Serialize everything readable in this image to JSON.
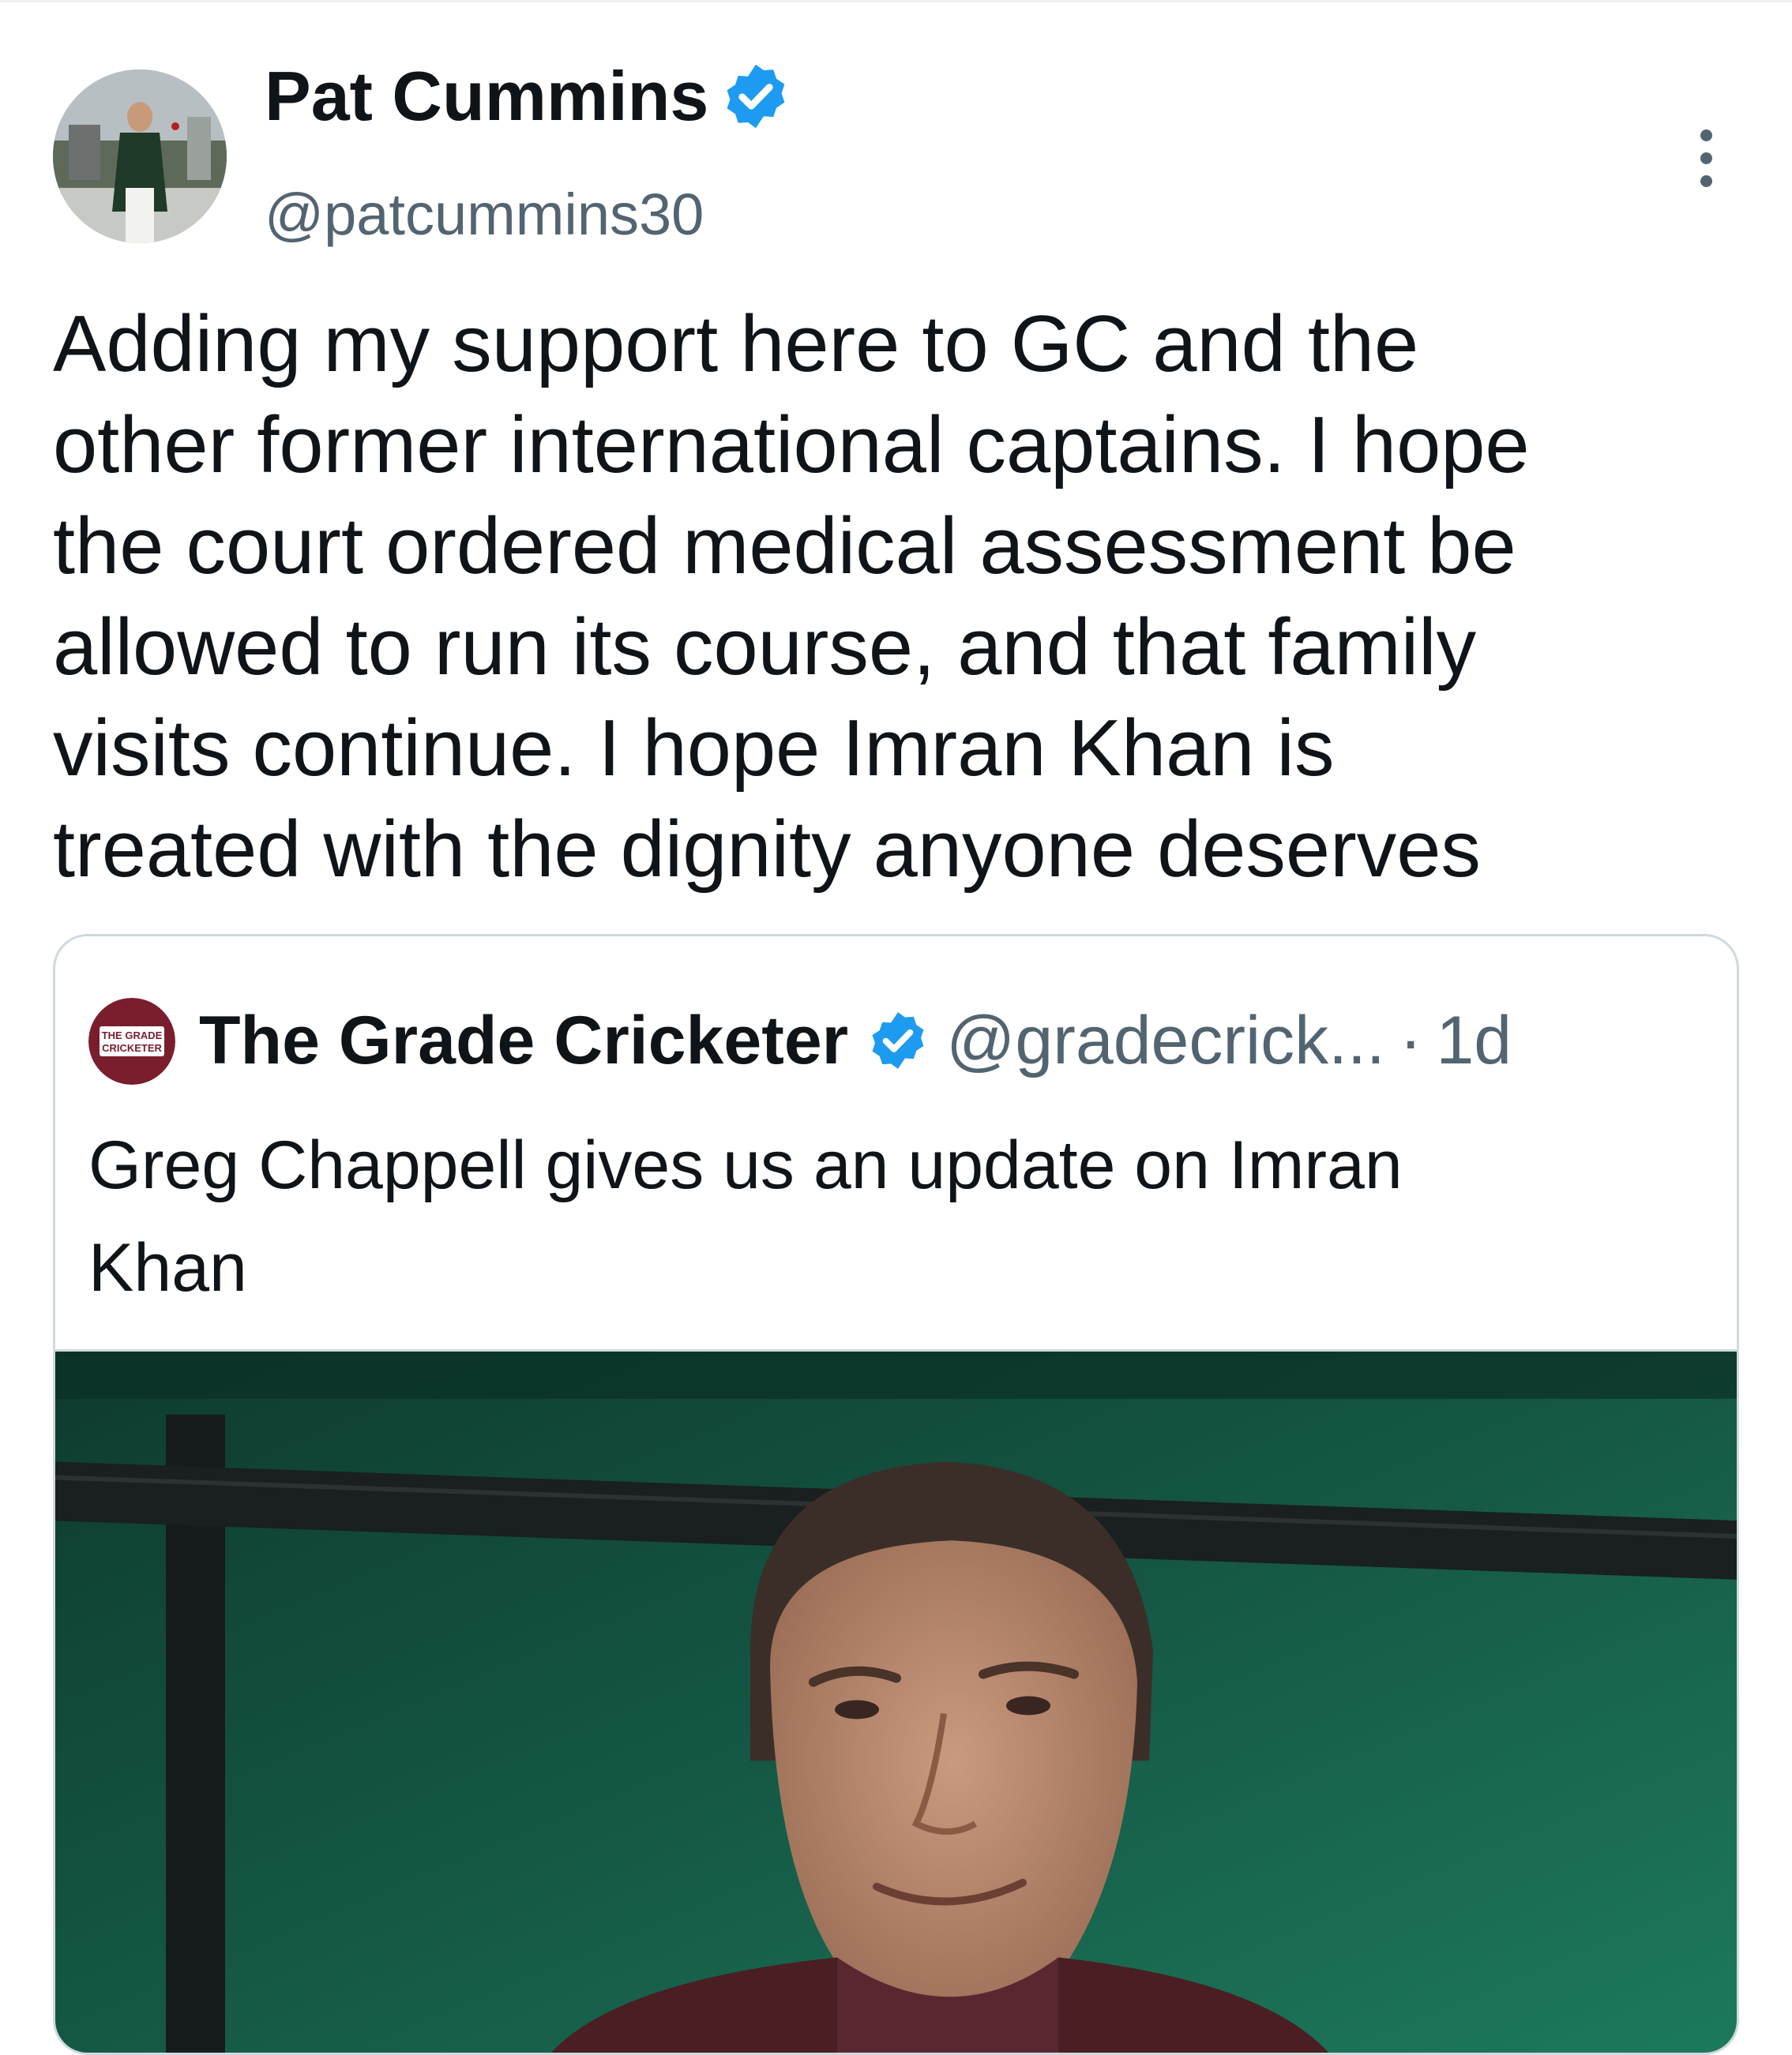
{
  "author": {
    "name": "Pat Cummins",
    "handle": "@patcummins30"
  },
  "tweet": {
    "lines": [
      "Adding my support here to GC and the",
      "other former international captains.  I hope",
      "the court ordered medical assessment be",
      "allowed to run its course, and that family",
      "visits continue. I hope Imran Khan is",
      "treated with the dignity anyone deserves"
    ]
  },
  "quoted": {
    "name": "The Grade Cricketer",
    "handle": "@gradecrick...",
    "separator": "·",
    "time": "1d",
    "avatar_text": [
      "THE GRADE",
      "CRICKETER"
    ],
    "lines": [
      "Greg Chappell gives us an update on Imran",
      "Khan"
    ]
  },
  "icons": {
    "verified": "verified-badge-icon",
    "more": "more-options-icon"
  },
  "colors": {
    "verified_blue": "#1d9bf0",
    "secondary_text": "#536471",
    "border": "#cfd9de",
    "quote_avatar": "#7a1e2e"
  }
}
